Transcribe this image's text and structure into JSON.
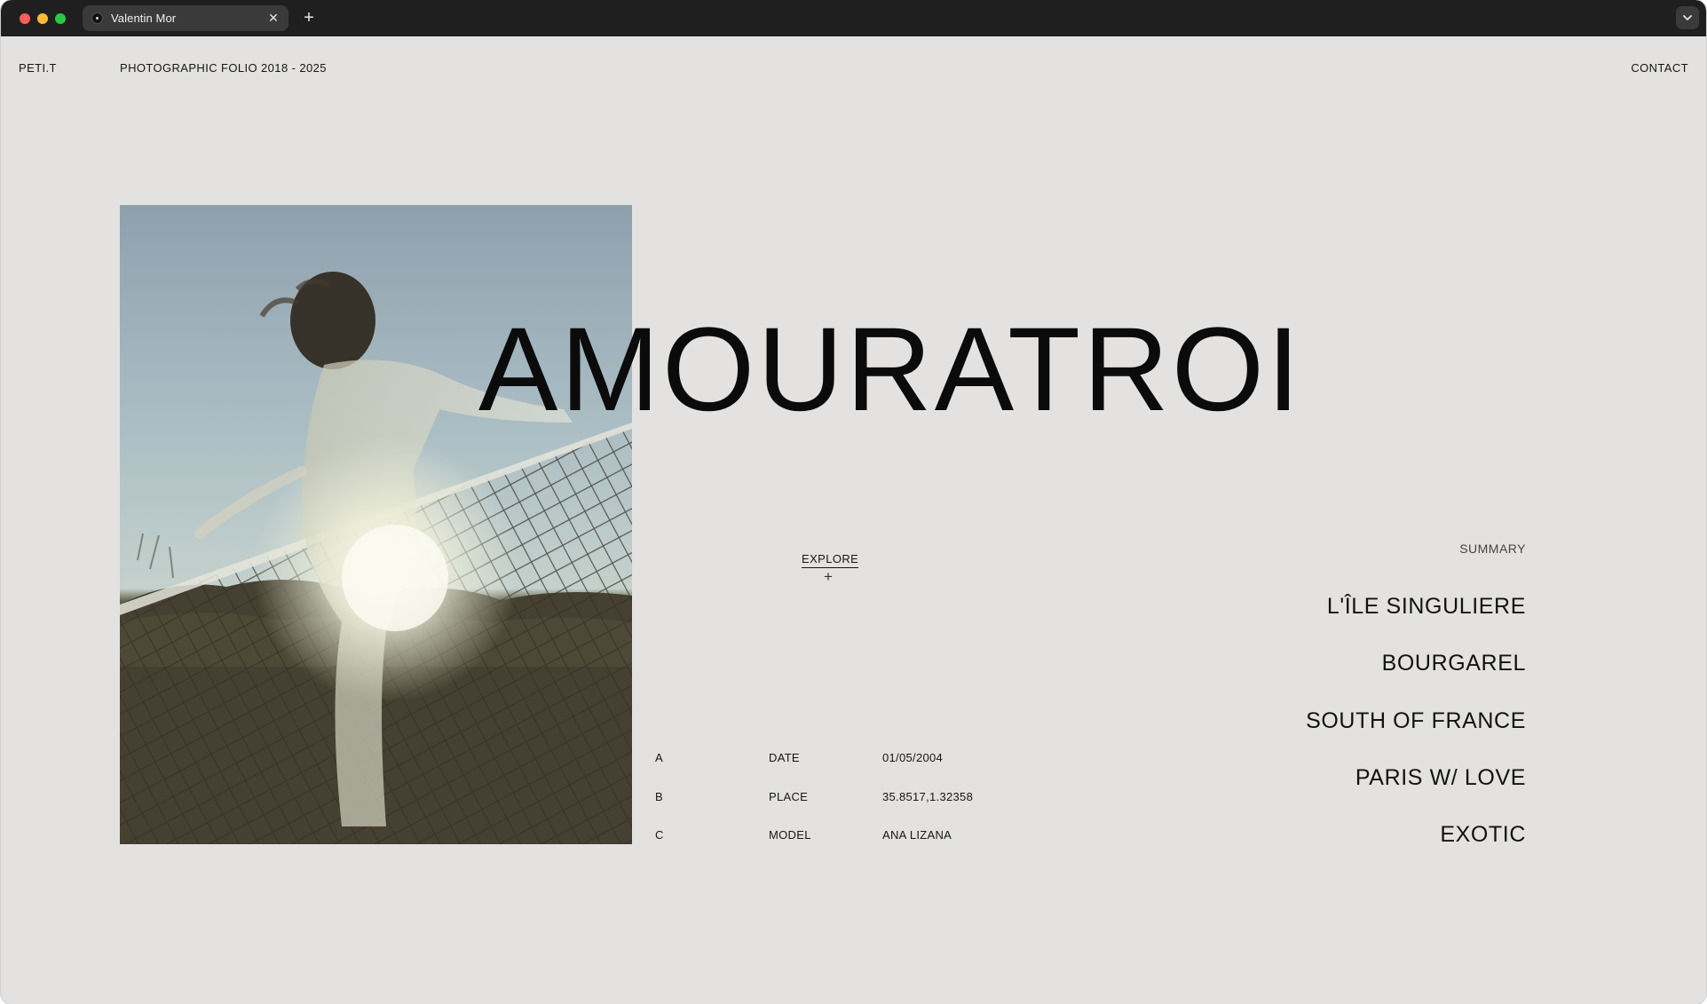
{
  "browser": {
    "tab_title": "Valentin Mor",
    "tab_close": "✕",
    "new_tab": "+"
  },
  "header": {
    "brand": "PETI.T",
    "folio": "PHOTOGRAPHIC FOLIO 2018 - 2025",
    "contact": "CONTACT"
  },
  "hero": {
    "title": "AMOURATROI",
    "explore_label": "EXPLORE",
    "explore_icon": "+"
  },
  "details": [
    {
      "key": "A",
      "label": "DATE",
      "value": "01/05/2004"
    },
    {
      "key": "B",
      "label": "PLACE",
      "value": "35.8517,1.32358"
    },
    {
      "key": "C",
      "label": "MODEL",
      "value": "ANA LIZANA"
    }
  ],
  "summary": {
    "label": "SUMMARY",
    "items": [
      "L'ÎLE SINGULIERE",
      "BOURGAREL",
      "SOUTH OF FRANCE",
      "PARIS W/ LOVE",
      "EXOTIC"
    ]
  },
  "colors": {
    "background": "#e3e2e0",
    "chrome": "#1f1f1f",
    "text": "#111111"
  }
}
